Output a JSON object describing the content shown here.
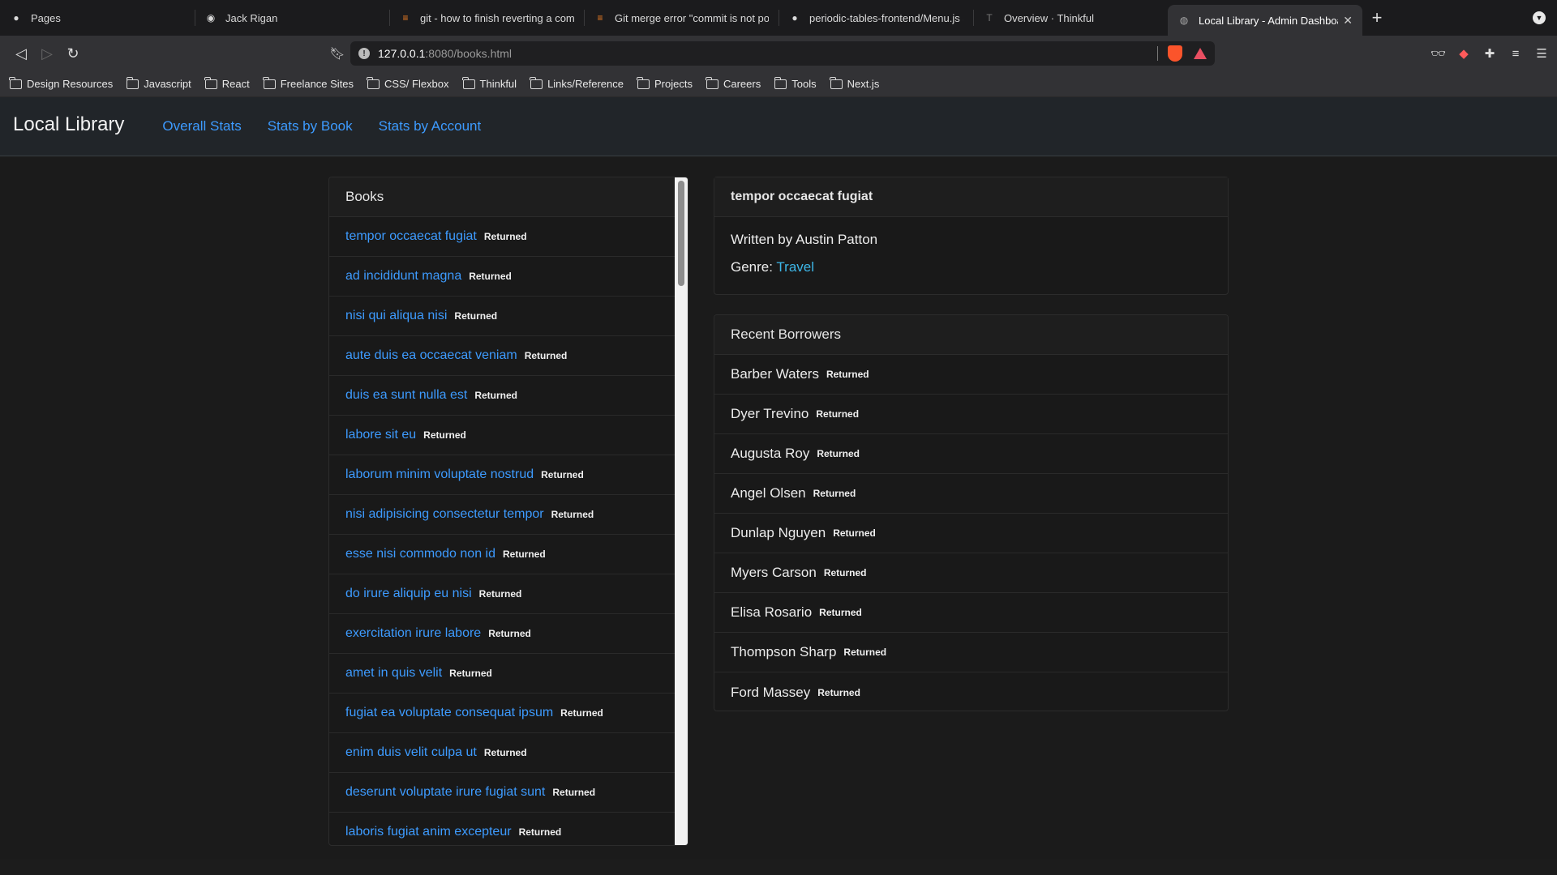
{
  "browser": {
    "tabs": [
      {
        "title": "Pages",
        "icon": "github-icon"
      },
      {
        "title": "Jack Rigan",
        "icon": "site-icon"
      },
      {
        "title": "git - how to finish reverting a comm",
        "icon": "stackoverflow-icon"
      },
      {
        "title": "Git merge error \"commit is not poss",
        "icon": "stackoverflow-icon"
      },
      {
        "title": "periodic-tables-frontend/Menu.js at",
        "icon": "github-icon"
      },
      {
        "title": "Overview · Thinkful",
        "icon": "thinkful-icon"
      },
      {
        "title": "Local Library - Admin Dashboard",
        "icon": "globe-icon",
        "active": true
      }
    ],
    "url_host": "127.0.0.1",
    "url_path": ":8080/books.html",
    "bookmarks": [
      "Design Resources",
      "Javascript",
      "React",
      "Freelance Sites",
      "CSS/ Flexbox",
      "Thinkful",
      "Links/Reference",
      "Projects",
      "Careers",
      "Tools",
      "Next.js"
    ]
  },
  "app": {
    "brand": "Local Library",
    "nav": [
      "Overall Stats",
      "Stats by Book",
      "Stats by Account"
    ]
  },
  "books_panel": {
    "header": "Books",
    "items": [
      {
        "title": "tempor occaecat fugiat",
        "status": "Returned"
      },
      {
        "title": "ad incididunt magna",
        "status": "Returned"
      },
      {
        "title": "nisi qui aliqua nisi",
        "status": "Returned"
      },
      {
        "title": "aute duis ea occaecat veniam",
        "status": "Returned"
      },
      {
        "title": "duis ea sunt nulla est",
        "status": "Returned"
      },
      {
        "title": "labore sit eu",
        "status": "Returned"
      },
      {
        "title": "laborum minim voluptate nostrud",
        "status": "Returned"
      },
      {
        "title": "nisi adipisicing consectetur tempor",
        "status": "Returned"
      },
      {
        "title": "esse nisi commodo non id",
        "status": "Returned"
      },
      {
        "title": "do irure aliquip eu nisi",
        "status": "Returned"
      },
      {
        "title": "exercitation irure labore",
        "status": "Returned"
      },
      {
        "title": "amet in quis velit",
        "status": "Returned"
      },
      {
        "title": "fugiat ea voluptate consequat ipsum",
        "status": "Returned"
      },
      {
        "title": "enim duis velit culpa ut",
        "status": "Returned"
      },
      {
        "title": "deserunt voluptate irure fugiat sunt",
        "status": "Returned"
      },
      {
        "title": "laboris fugiat anim excepteur",
        "status": "Returned"
      }
    ]
  },
  "detail_panel": {
    "title": "tempor occaecat fugiat",
    "author_line": "Written by Austin Patton",
    "genre_label": "Genre:",
    "genre": "Travel"
  },
  "borrowers_panel": {
    "header": "Recent Borrowers",
    "items": [
      {
        "name": "Barber Waters",
        "status": "Returned"
      },
      {
        "name": "Dyer Trevino",
        "status": "Returned"
      },
      {
        "name": "Augusta Roy",
        "status": "Returned"
      },
      {
        "name": "Angel Olsen",
        "status": "Returned"
      },
      {
        "name": "Dunlap Nguyen",
        "status": "Returned"
      },
      {
        "name": "Myers Carson",
        "status": "Returned"
      },
      {
        "name": "Elisa Rosario",
        "status": "Returned"
      },
      {
        "name": "Thompson Sharp",
        "status": "Returned"
      },
      {
        "name": "Ford Massey",
        "status": "Returned"
      }
    ]
  }
}
